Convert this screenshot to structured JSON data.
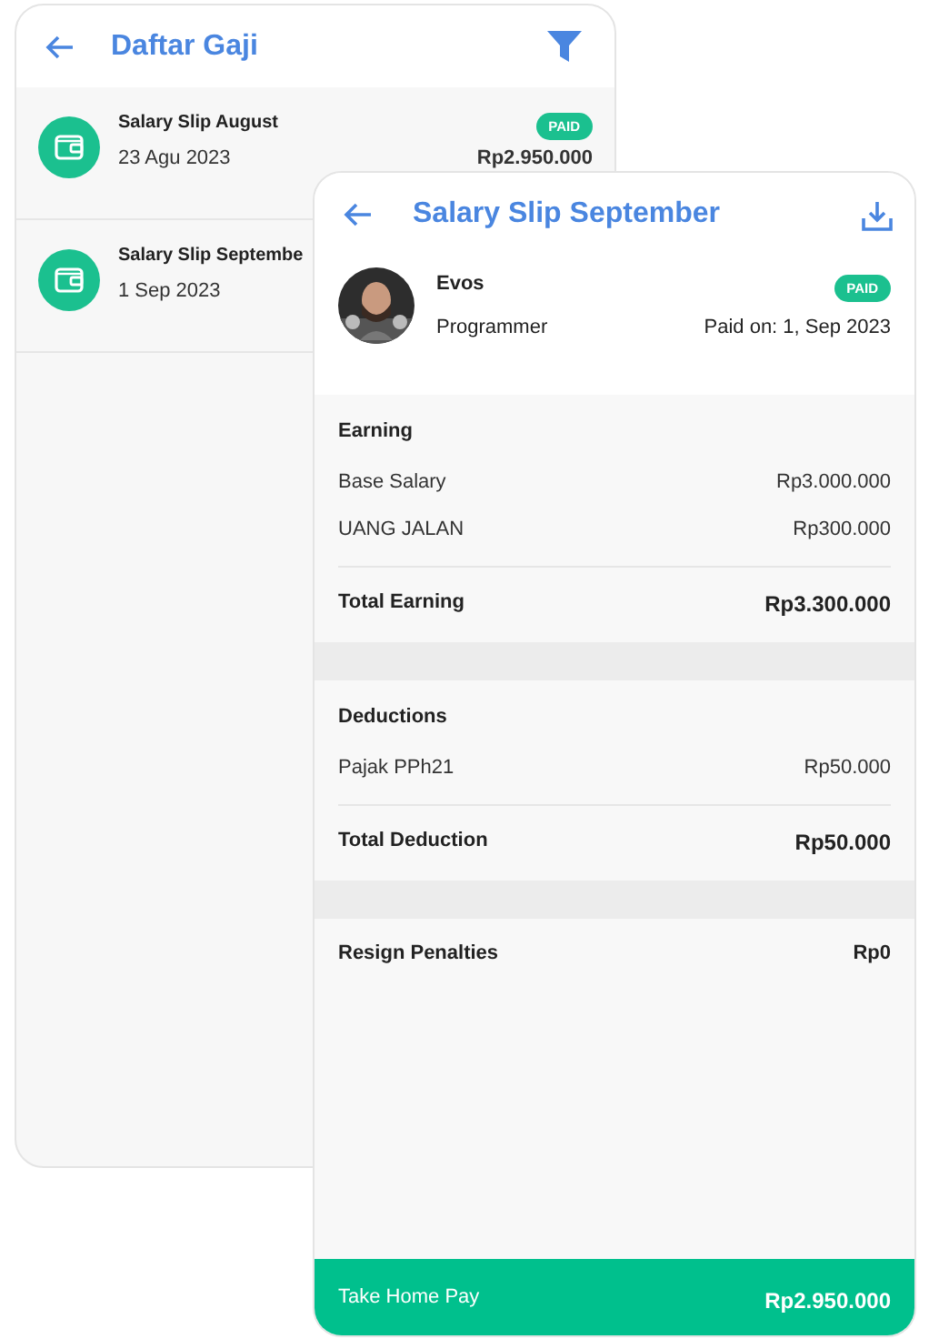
{
  "list_screen": {
    "title": "Daftar Gaji",
    "items": [
      {
        "title": "Salary Slip August",
        "date": "23 Agu 2023",
        "status": "PAID",
        "amount": "Rp2.950.000"
      },
      {
        "title": "Salary Slip Septembe",
        "date": "1 Sep 2023"
      }
    ]
  },
  "detail_screen": {
    "title": "Salary Slip September",
    "employee": {
      "name": "Evos",
      "role": "Programmer",
      "status": "PAID",
      "paid_on": "Paid on: 1, Sep 2023"
    },
    "sections": [
      {
        "title": "Earning",
        "items": [
          {
            "label": "Base Salary",
            "value": "Rp3.000.000"
          },
          {
            "label": "UANG JALAN",
            "value": "Rp300.000"
          }
        ],
        "total": {
          "label": "Total Earning",
          "value": "Rp3.300.000"
        }
      },
      {
        "title": "Deductions",
        "items": [
          {
            "label": "Pajak PPh21",
            "value": "Rp50.000"
          }
        ],
        "total": {
          "label": "Total Deduction",
          "value": "Rp50.000"
        }
      }
    ],
    "penalties": {
      "label": "Resign Penalties",
      "value": "Rp0"
    },
    "take_home": {
      "label": "Take Home Pay",
      "value": "Rp2.950.000"
    }
  }
}
